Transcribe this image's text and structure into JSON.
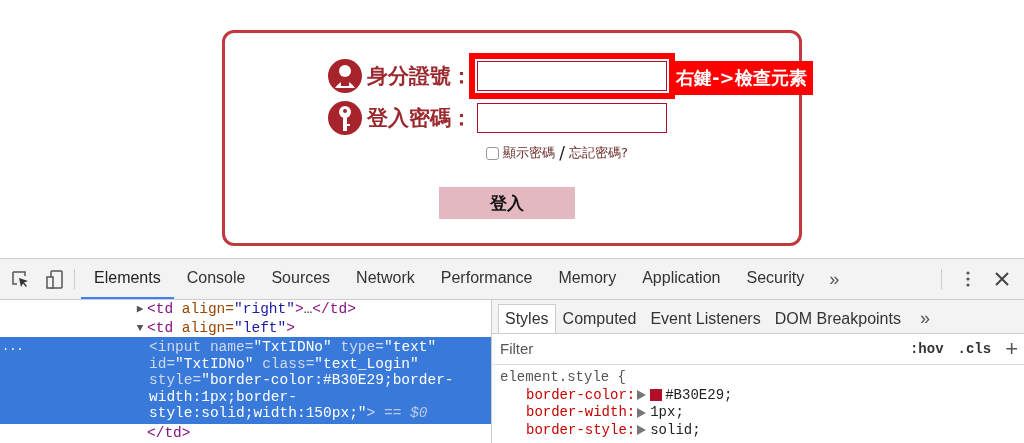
{
  "login_form": {
    "fields": [
      {
        "kind": "id",
        "label": "身分證號：",
        "highlighted": true
      },
      {
        "kind": "password",
        "label": "登入密碼：",
        "highlighted": false
      }
    ],
    "annotation": "右鍵->檢查元素",
    "show_password": {
      "label": "顯示密碼",
      "checked": false
    },
    "separator": "/",
    "forgot_link": "忘記密碼?",
    "submit": "登入"
  },
  "devtools": {
    "tabs": [
      {
        "label": "Elements",
        "selected": true
      },
      {
        "label": "Console",
        "selected": false
      },
      {
        "label": "Sources",
        "selected": false
      },
      {
        "label": "Network",
        "selected": false
      },
      {
        "label": "Performance",
        "selected": false
      },
      {
        "label": "Memory",
        "selected": false
      },
      {
        "label": "Application",
        "selected": false
      },
      {
        "label": "Security",
        "selected": false
      }
    ],
    "more": "»",
    "dom": [
      {
        "expander": "▶",
        "tokens": [
          {
            "kind": "tag",
            "t": "<td"
          },
          {
            "kind": "attr",
            "t": " align="
          },
          {
            "kind": "value",
            "t": "\"right\""
          },
          {
            "kind": "tag",
            "t": ">"
          },
          {
            "kind": "text",
            "t": "…"
          },
          {
            "kind": "tag",
            "t": "</td>"
          }
        ]
      },
      {
        "expander": "▼",
        "tokens": [
          {
            "kind": "tag",
            "t": "<td"
          },
          {
            "kind": "attr",
            "t": " align="
          },
          {
            "kind": "value",
            "t": "\"left\""
          },
          {
            "kind": "tag",
            "t": ">"
          }
        ],
        "children": [
          {
            "selected": true,
            "marker": "...",
            "tokens": [
              {
                "kind": "tag",
                "t": "<input"
              },
              {
                "kind": "attr",
                "t": " name="
              },
              {
                "kind": "value",
                "t": "\"TxtIDNo\""
              },
              {
                "kind": "attr",
                "t": " type="
              },
              {
                "kind": "value",
                "t": "\"text\""
              },
              {
                "kind": "attr",
                "t": " id="
              },
              {
                "kind": "value",
                "t": "\"TxtIDNo\""
              },
              {
                "kind": "attr",
                "t": " class="
              },
              {
                "kind": "value",
                "t": "\"text_Login\""
              },
              {
                "kind": "attr",
                "t": " style="
              },
              {
                "kind": "value",
                "t": "\"border-color:#B30E29;border-width:1px;border-style:solid;width:150px;\""
              },
              {
                "kind": "tag",
                "t": ">"
              },
              {
                "kind": "ref",
                "t": " == "
              },
              {
                "kind": "ref",
                "t": "$0"
              }
            ]
          }
        ],
        "closing": [
          {
            "kind": "tag",
            "t": "</td>"
          }
        ]
      }
    ],
    "sidebar": {
      "tabs": [
        {
          "label": "Styles",
          "selected": true
        },
        {
          "label": "Computed",
          "selected": false
        },
        {
          "label": "Event Listeners",
          "selected": false
        },
        {
          "label": "DOM Breakpoints",
          "selected": false
        }
      ],
      "more": "»",
      "filter": {
        "placeholder": "Filter"
      },
      "hov": ":hov",
      "cls": ".cls",
      "add": "+",
      "selector": "element.style {",
      "declarations": [
        {
          "property": "border-color:",
          "value": "#B30E29;",
          "color": "#b30e29"
        },
        {
          "property": "border-width:",
          "value": "1px;"
        },
        {
          "property": "border-style:",
          "value": "solid;"
        }
      ]
    }
  }
}
